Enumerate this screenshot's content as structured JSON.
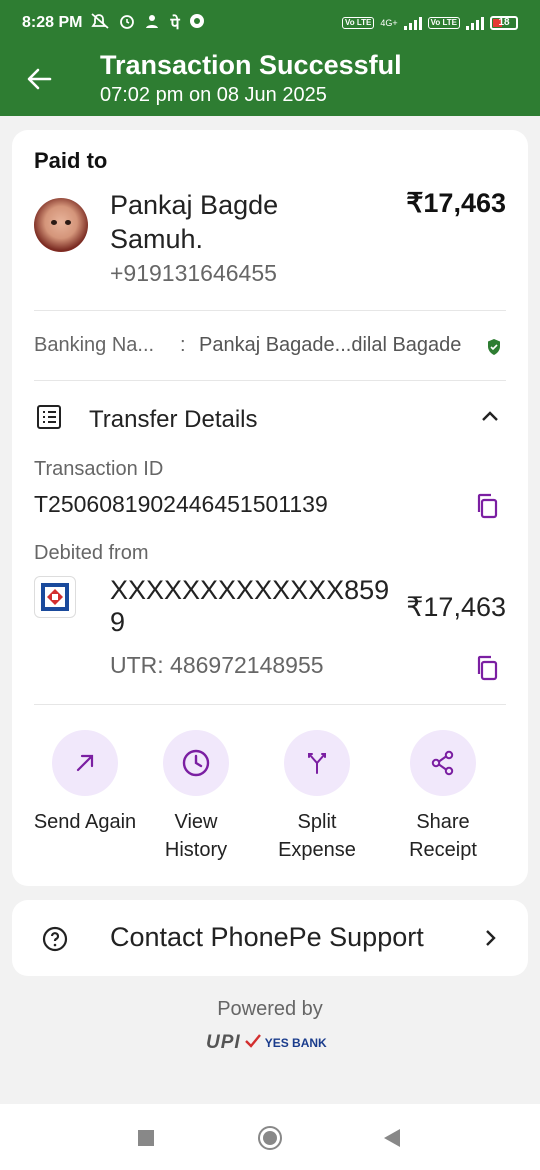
{
  "status_bar": {
    "time": "8:28 PM",
    "net_type": "4G+",
    "volte_1": "Vo LTE",
    "volte_2": "Vo LTE",
    "battery": "18"
  },
  "header": {
    "title": "Transaction Successful",
    "subtitle": "07:02 pm on 08 Jun 2025",
    "bg_color": "#2e7d32"
  },
  "paid_to": {
    "label": "Paid to",
    "name": "Pankaj Bagde Samuh.",
    "phone": "+919131646455",
    "amount": "₹17,463",
    "banking_name_label": "Banking Na...",
    "banking_name_sep": ":",
    "banking_name_value": "Pankaj Bagade...dilal Bagade"
  },
  "transfer_details": {
    "title": "Transfer Details",
    "transaction_id_label": "Transaction ID",
    "transaction_id": "T2506081902446451501139",
    "debited_from_label": "Debited from",
    "account": "XXXXXXXXXXXXX8599",
    "account_amount": "₹17,463",
    "utr": "UTR: 486972148955"
  },
  "actions": [
    {
      "label": "Send Again",
      "icon": "arrow-up-right-icon"
    },
    {
      "label": "View History",
      "icon": "clock-icon"
    },
    {
      "label": "Split Expense",
      "icon": "split-icon"
    },
    {
      "label": "Share Receipt",
      "icon": "share-icon"
    }
  ],
  "support": {
    "label": "Contact PhonePe Support"
  },
  "footer": {
    "powered_by": "Powered by",
    "upi": "UPI",
    "bank": "YES BANK"
  },
  "colors": {
    "accent": "#7b1fa2",
    "success_green": "#2e7d32"
  }
}
